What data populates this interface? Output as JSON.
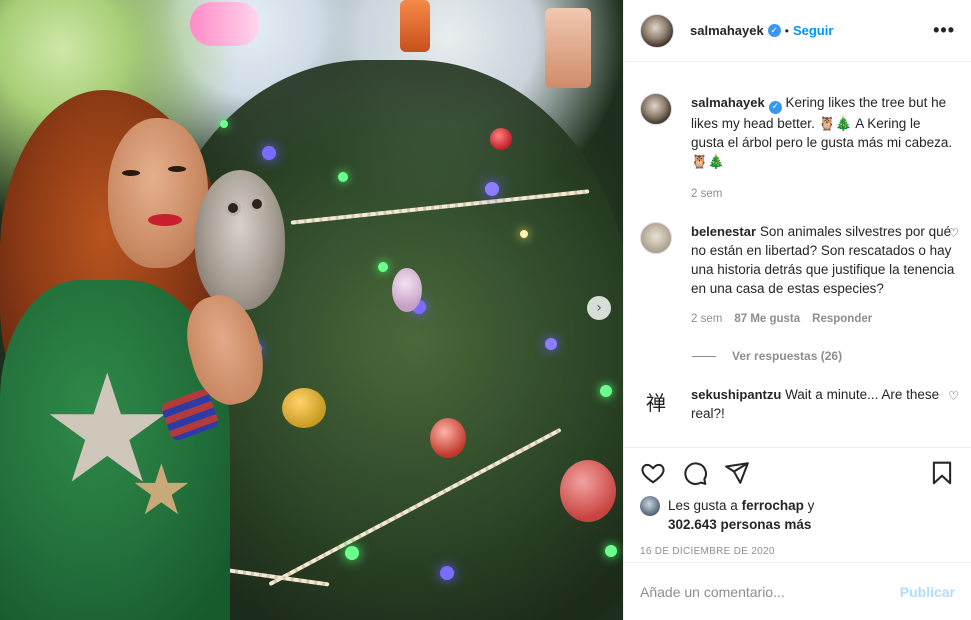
{
  "post": {
    "username": "salmahayek",
    "follow_label": "Seguir",
    "more_label": "•••",
    "verified_mark": "✓"
  },
  "caption": {
    "username": "salmahayek",
    "text": "Kering likes the tree but he likes my head better. 🦉🎄 A Kering le gusta el árbol pero le gusta más mi cabeza. 🦉🎄",
    "time": "2 sem"
  },
  "comments": [
    {
      "username": "belenestar",
      "text": "Son animales silvestres por qué no están en libertad? Son rescatados o hay una historia detrás que justifique la tenencia en una casa de estas especies?",
      "time": "2 sem",
      "likes": "87 Me gusta",
      "reply_label": "Responder",
      "view_replies": "Ver respuestas (26)"
    },
    {
      "username": "sekushipantzu",
      "avatar_glyph": "禅",
      "text": "Wait a minute... Are these real?!"
    }
  ],
  "likes": {
    "prefix": "Les gusta a",
    "user": "ferrochap",
    "connector": "y",
    "others": "302.643 personas más"
  },
  "date": "16 DE DICIEMBRE DE 2020",
  "add_comment": {
    "placeholder": "Añade un comentario...",
    "publish_label": "Publicar"
  },
  "icons": {
    "like": "heart-icon",
    "comment": "comment-icon",
    "share": "share-icon",
    "save": "bookmark-icon",
    "next": "chevron-right-icon"
  },
  "colors": {
    "accent": "#0095f6",
    "verified": "#3897f0",
    "publish_disabled": "#b3dbff",
    "muted": "#8e8e8e"
  }
}
